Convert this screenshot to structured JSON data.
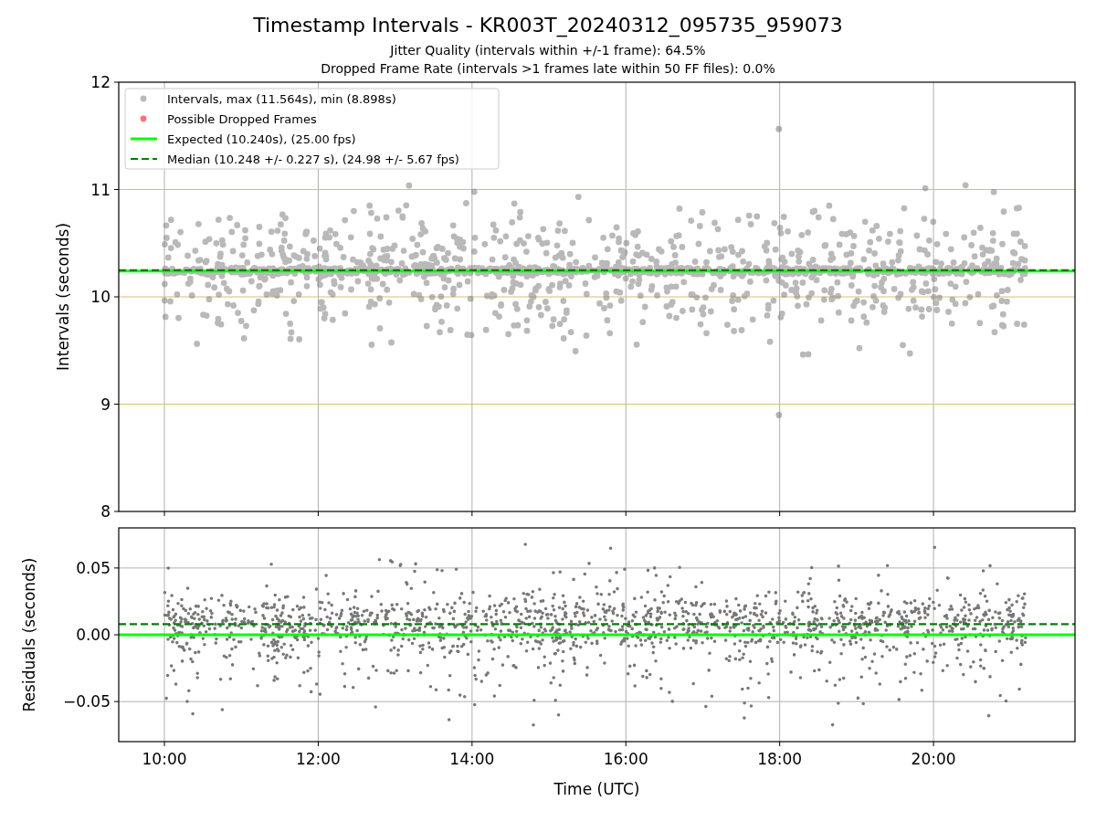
{
  "figure": {
    "title": "Timestamp Intervals - KR003T_20240312_095735_959073",
    "subtitles": [
      "Jitter Quality (intervals within +/-1 frame): 64.5%",
      "Dropped Frame Rate (intervals >1 frames late within 50 FF files): 0.0%"
    ]
  },
  "intervals_plot": {
    "chart_data": {
      "type": "scatter",
      "ylabel": "Intervals (seconds)",
      "xlim": [
        9.406,
        21.84
      ],
      "ylim": [
        8,
        12
      ],
      "grid": true,
      "legend": "upper left",
      "yticks": [
        {
          "value": 8,
          "label": "8"
        },
        {
          "value": 9,
          "label": "9"
        },
        {
          "value": 10,
          "label": "10"
        },
        {
          "value": 11,
          "label": "11"
        },
        {
          "value": 12,
          "label": "12"
        }
      ],
      "series": [
        {
          "name": "Intervals, max (11.564s), min (8.898s)",
          "color": "#808080",
          "x": [
            17.99,
            17.99
          ],
          "values": [
            11.564,
            8.898
          ]
        },
        {
          "name": "Possible Dropped Frames",
          "color": "#ff0000"
        }
      ],
      "ref_lines": [
        {
          "axis": "y",
          "value": 10.24,
          "label": "Expected (10.240s), (25.00 fps)",
          "color": "#00ff00",
          "line_style": "solid"
        },
        {
          "axis": "y",
          "value": 10.248,
          "label": "Median (10.248 +/- 0.227 s), (24.98 +/- 5.67 fps)",
          "color": "#008000",
          "line_style": "dashed"
        }
      ]
    }
  },
  "residuals_plot": {
    "chart_data": {
      "type": "scatter",
      "xlabel": "Time (UTC)",
      "ylabel": "Residuals (seconds)",
      "xlim": [
        9.406,
        21.84
      ],
      "ylim": [
        -0.08,
        0.08
      ],
      "grid": true,
      "xticks": [
        {
          "value": 10,
          "label": "10:00"
        },
        {
          "value": 12,
          "label": "12:00"
        },
        {
          "value": 14,
          "label": "14:00"
        },
        {
          "value": 16,
          "label": "16:00"
        },
        {
          "value": 18,
          "label": "18:00"
        },
        {
          "value": 20,
          "label": "20:00"
        }
      ],
      "yticks": [
        {
          "value": -0.05,
          "label": "−0.05"
        },
        {
          "value": 0,
          "label": "0.00"
        },
        {
          "value": 0.05,
          "label": "0.05"
        }
      ],
      "ref_lines": [
        {
          "axis": "y",
          "value": 0,
          "color": "#00ff00",
          "line_style": "solid"
        },
        {
          "axis": "y",
          "value": 0.008,
          "color": "#008000",
          "line_style": "dashed"
        }
      ]
    }
  }
}
